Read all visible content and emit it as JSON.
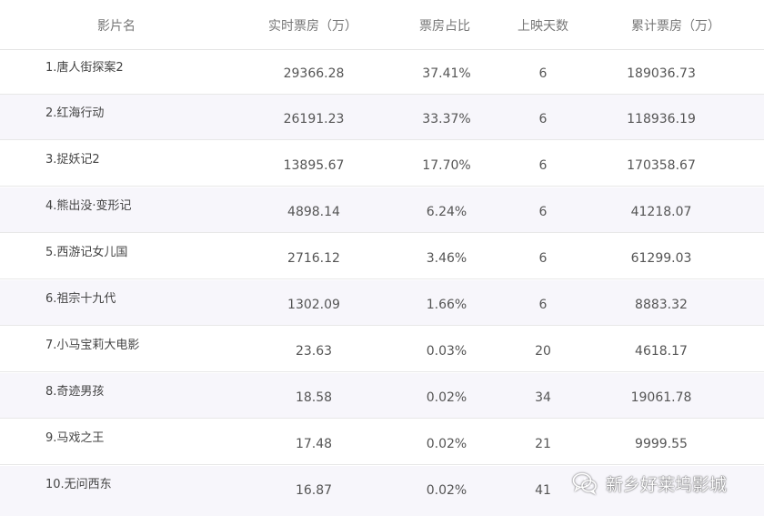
{
  "table": {
    "columns": [
      "影片名",
      "实时票房（万）",
      "票房占比",
      "上映天数",
      "累计票房（万）"
    ],
    "rows": [
      {
        "name": "1.唐人街探案2",
        "realtime": "29366.28",
        "share": "37.41%",
        "days": "6",
        "total": "189036.73"
      },
      {
        "name": "2.红海行动",
        "realtime": "26191.23",
        "share": "33.37%",
        "days": "6",
        "total": "118936.19"
      },
      {
        "name": "3.捉妖记2",
        "realtime": "13895.67",
        "share": "17.70%",
        "days": "6",
        "total": "170358.67"
      },
      {
        "name": "4.熊出没·变形记",
        "realtime": "4898.14",
        "share": "6.24%",
        "days": "6",
        "total": "41218.07"
      },
      {
        "name": "5.西游记女儿国",
        "realtime": "2716.12",
        "share": "3.46%",
        "days": "6",
        "total": "61299.03"
      },
      {
        "name": "6.祖宗十九代",
        "realtime": "1302.09",
        "share": "1.66%",
        "days": "6",
        "total": "8883.32"
      },
      {
        "name": "7.小马宝莉大电影",
        "realtime": "23.63",
        "share": "0.03%",
        "days": "20",
        "total": "4618.17"
      },
      {
        "name": "8.奇迹男孩",
        "realtime": "18.58",
        "share": "0.02%",
        "days": "34",
        "total": "19061.78"
      },
      {
        "name": "9.马戏之王",
        "realtime": "17.48",
        "share": "0.02%",
        "days": "21",
        "total": "9999.55"
      },
      {
        "name": "10.无问西东",
        "realtime": "16.87",
        "share": "0.02%",
        "days": "41",
        "total": ""
      }
    ]
  },
  "watermark": {
    "text": "新乡好莱坞影城",
    "icon": "wechat-icon"
  }
}
